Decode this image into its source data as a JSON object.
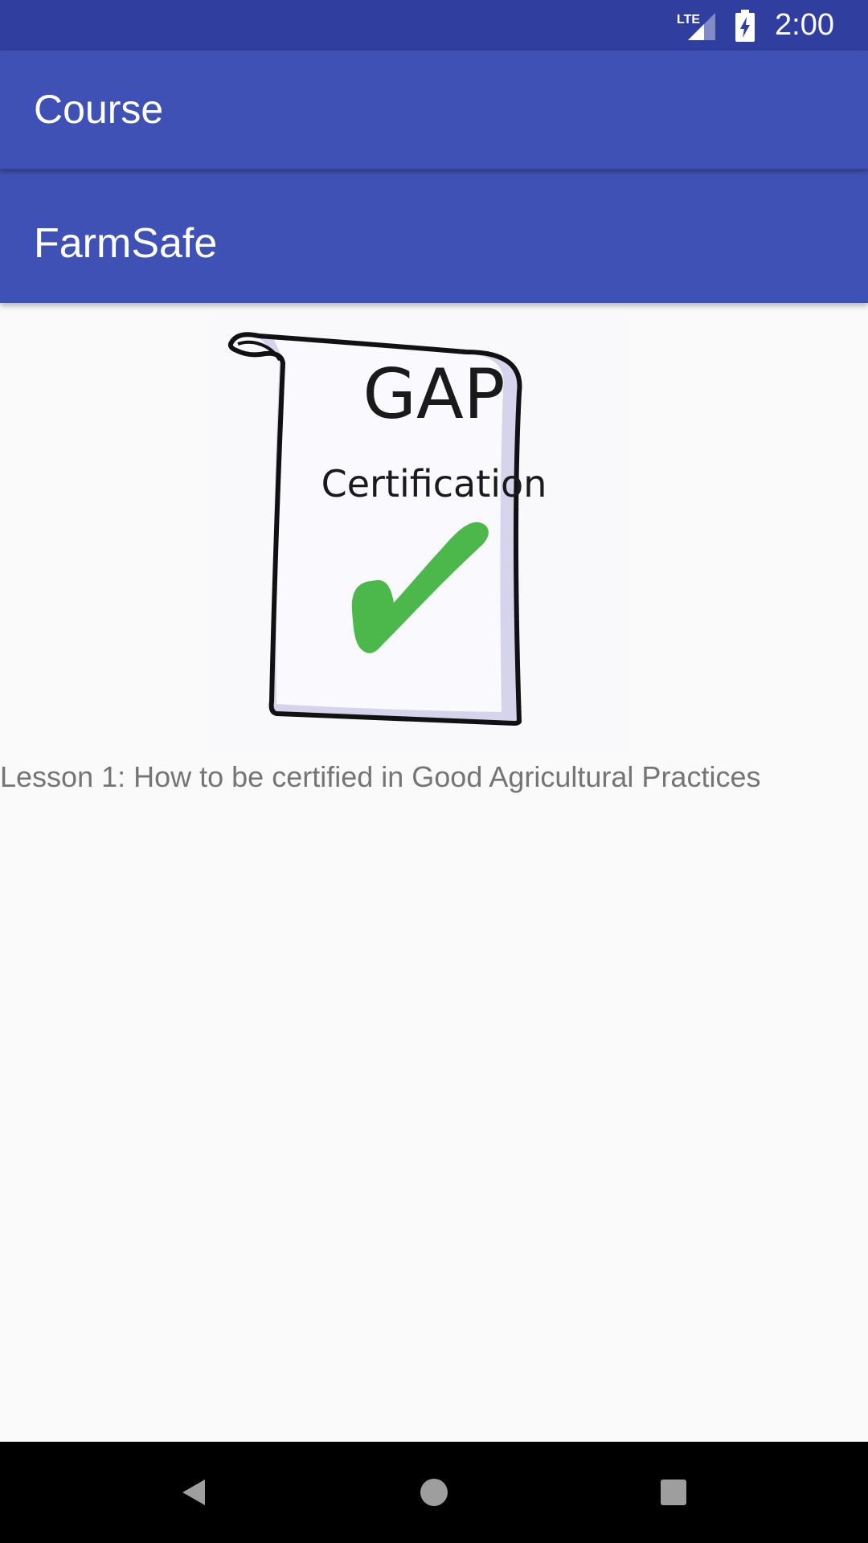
{
  "status_bar": {
    "network": "LTE",
    "time": "2:00",
    "icons": [
      "lte-signal-icon",
      "battery-charging-icon"
    ]
  },
  "toolbar": {
    "title": "Course"
  },
  "course": {
    "name": "FarmSafe",
    "image": {
      "title": "GAP",
      "subtitle": "Certification",
      "icon": "checkmark-icon"
    },
    "lesson": "Lesson 1: How to be certified in Good Agricultural Practices"
  },
  "nav_bar": {
    "icons": [
      "back-icon",
      "home-icon",
      "recents-icon"
    ]
  },
  "colors": {
    "status_bar": "#303f9f",
    "primary": "#3f51b5",
    "background": "#fafafa",
    "lesson_text": "#757575",
    "check": "#4cb84c"
  }
}
